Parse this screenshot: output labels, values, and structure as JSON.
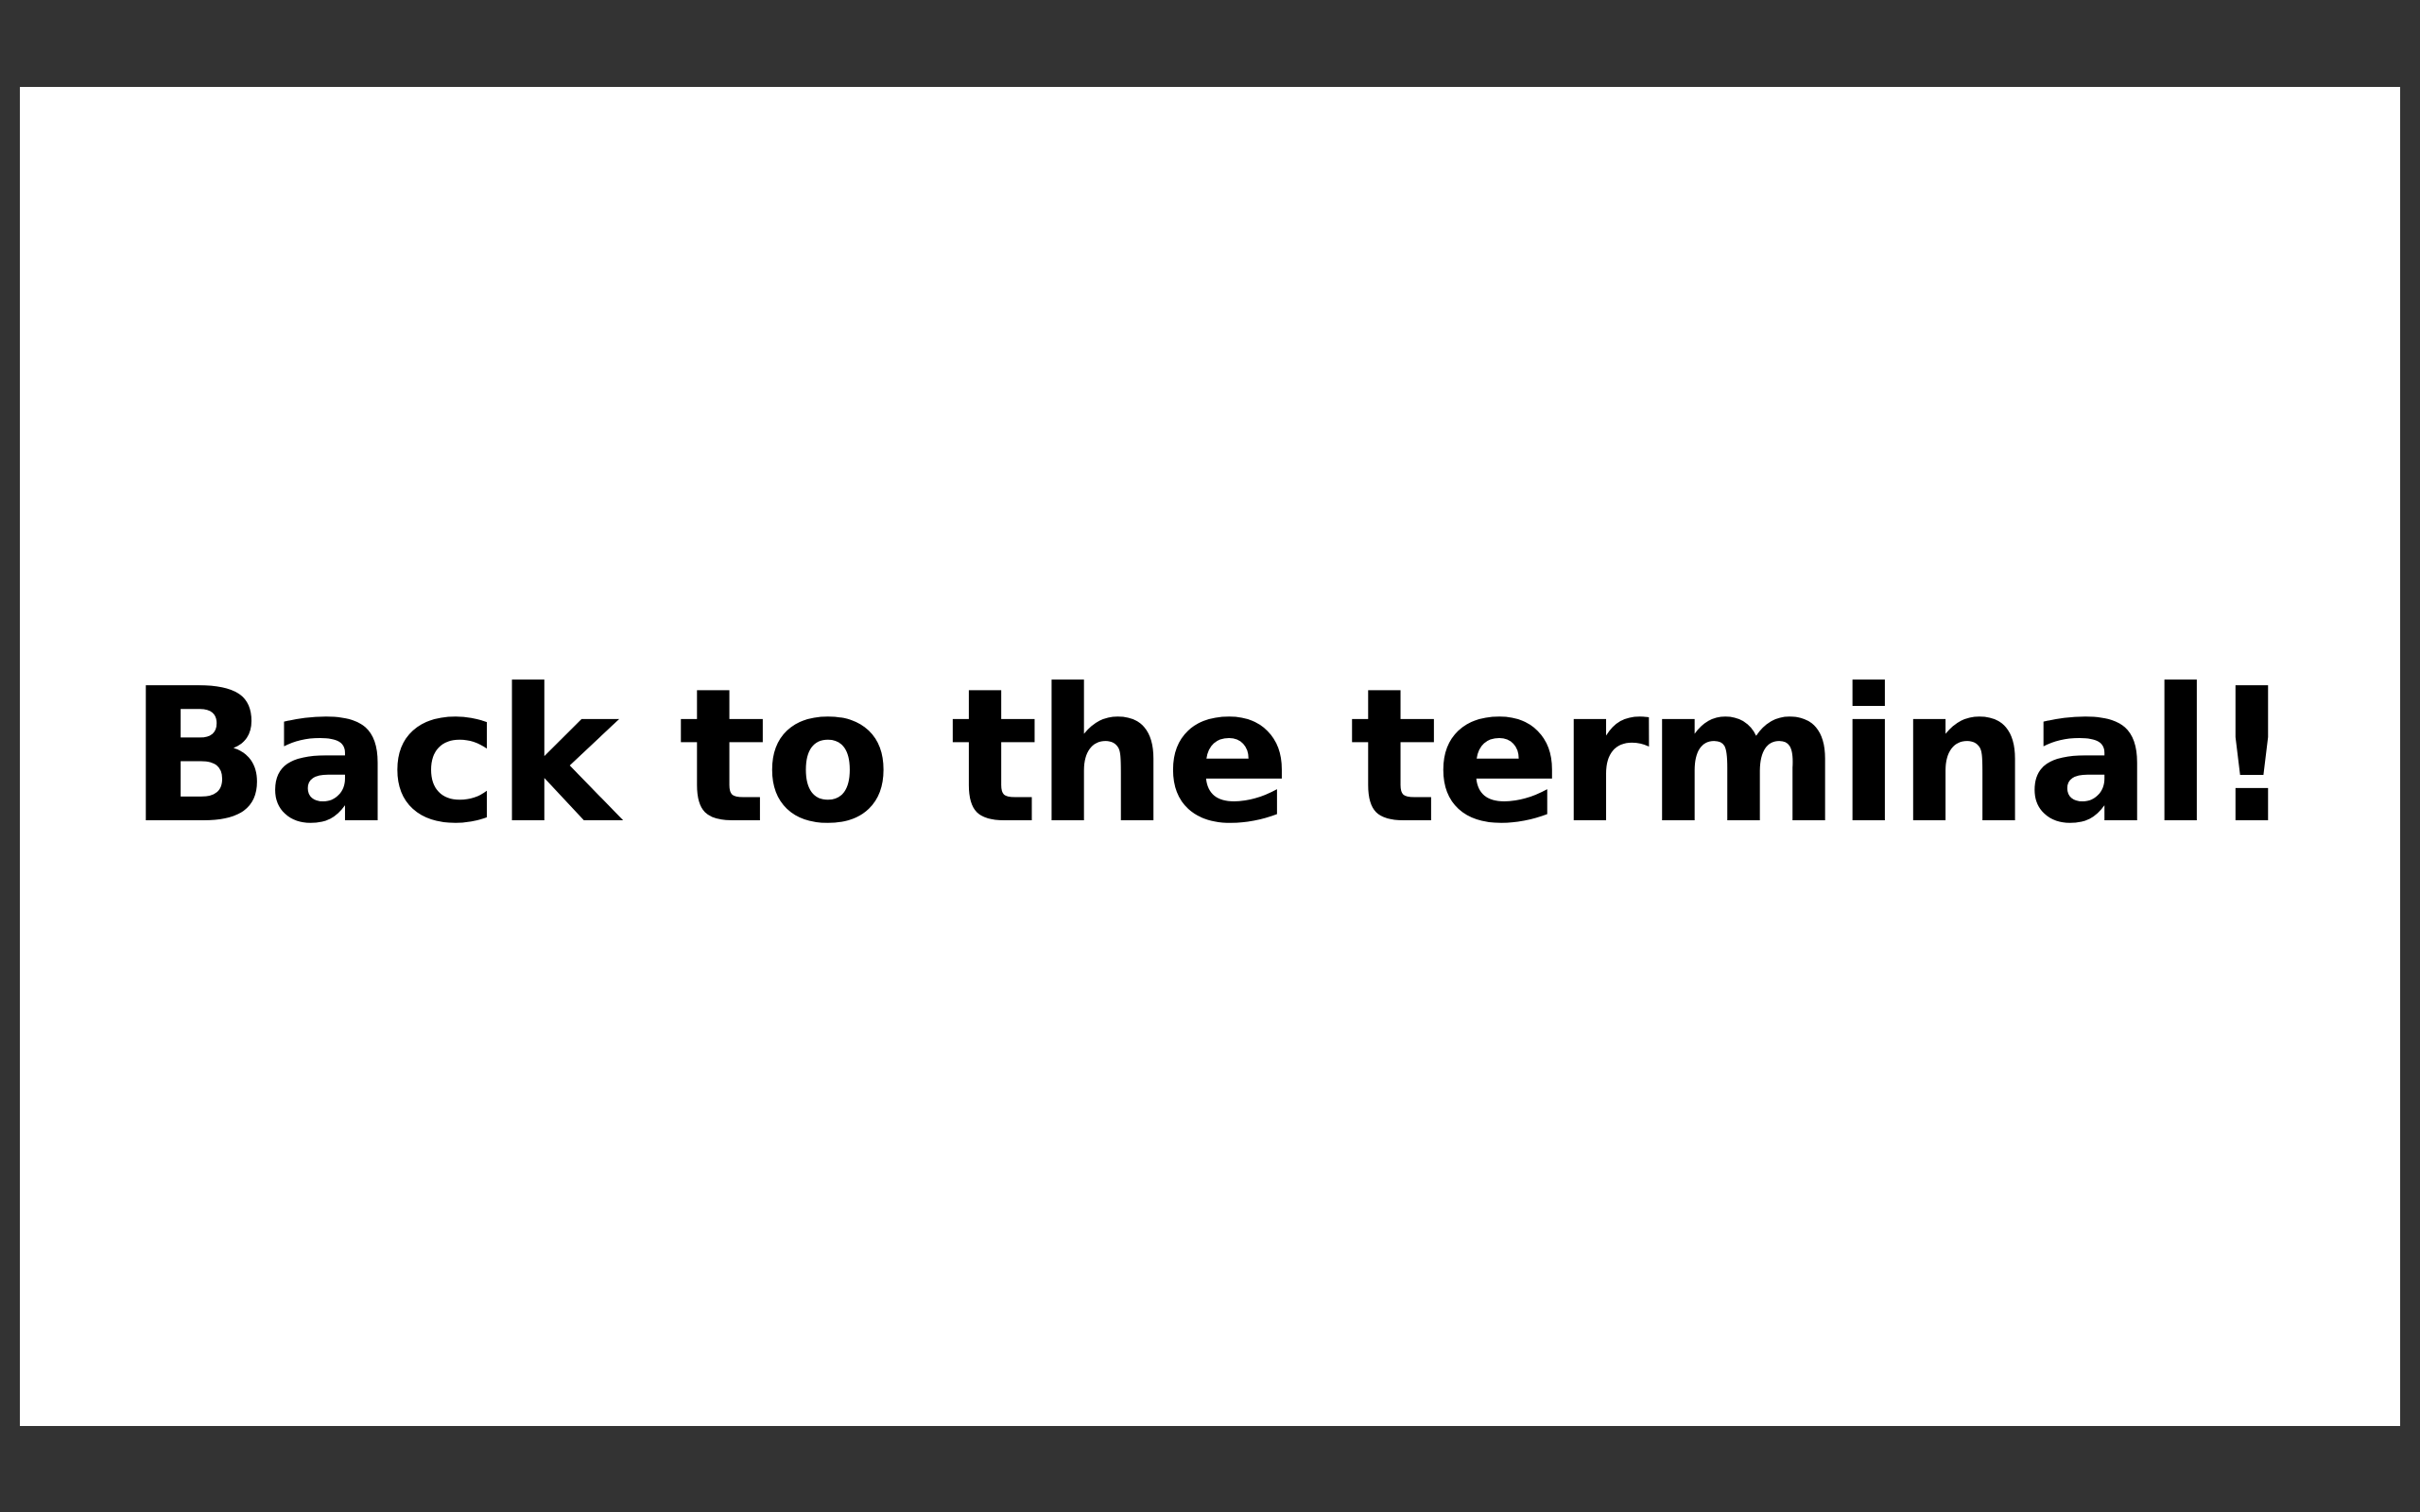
{
  "presentation": {
    "background_color": "#333333",
    "slide_color": "#ffffff",
    "text_color": "#000000",
    "current_slide": {
      "title": "Back to the terminal!"
    }
  }
}
